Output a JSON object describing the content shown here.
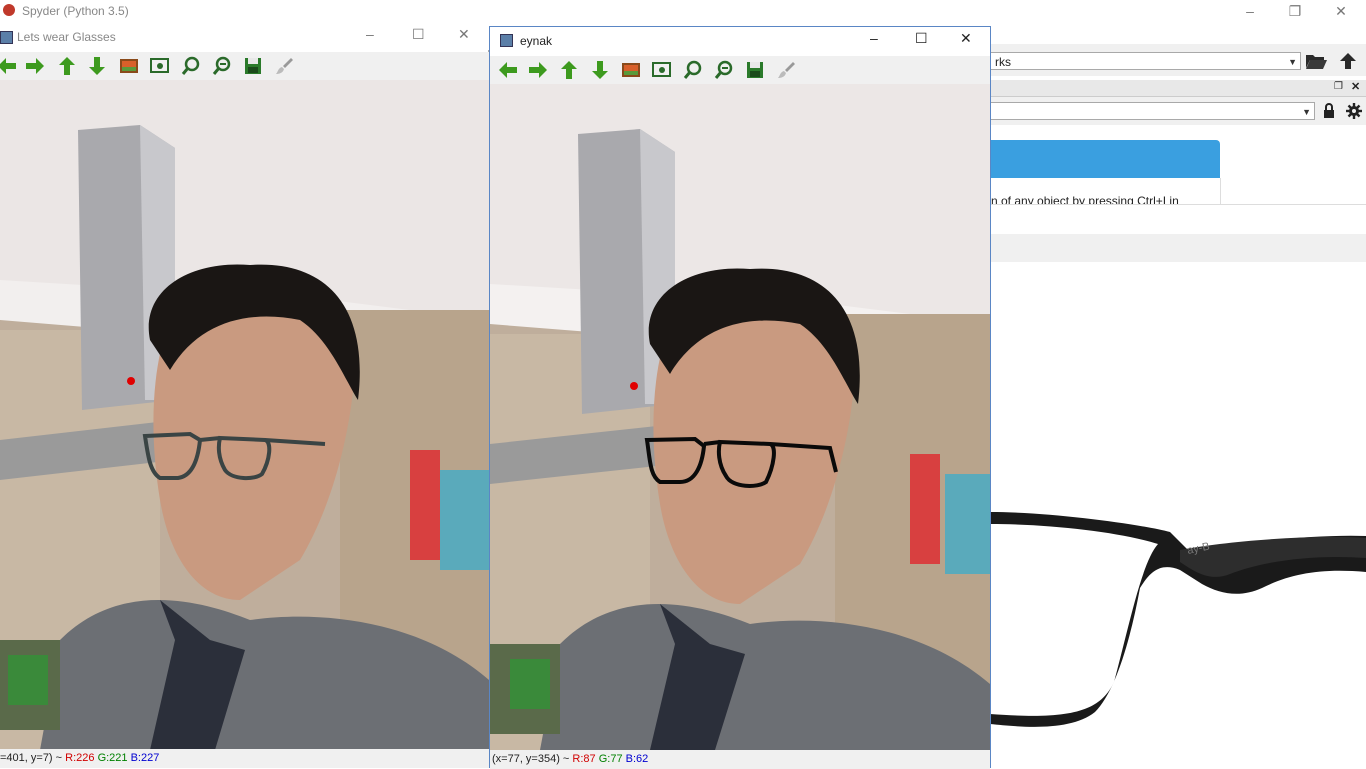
{
  "spyder": {
    "title": "Spyder (Python 3.5)",
    "path_combo": "rks",
    "help_text": "n of any object by pressing Ctrl+I in"
  },
  "window_left": {
    "title": "Lets wear Glasses",
    "status_prefix": "=401, y=7) ~ ",
    "r": "R:226",
    "g": "G:221",
    "b": "B:227"
  },
  "window_right": {
    "title": "eynak",
    "status_prefix": "(x=77, y=354) ~ ",
    "r": "R:87",
    "g": "G:77",
    "b": "B:62"
  },
  "glasses_image": {
    "brand_text": "ay-B"
  },
  "icons": [
    "back-arrow-icon",
    "forward-arrow-icon",
    "up-arrow-icon",
    "down-arrow-icon",
    "image-icon",
    "zoom-window-icon",
    "zoom-in-icon",
    "zoom-out-icon",
    "save-icon",
    "brush-icon",
    "folder-open-icon",
    "up-dir-icon",
    "lock-icon",
    "gear-icon"
  ]
}
